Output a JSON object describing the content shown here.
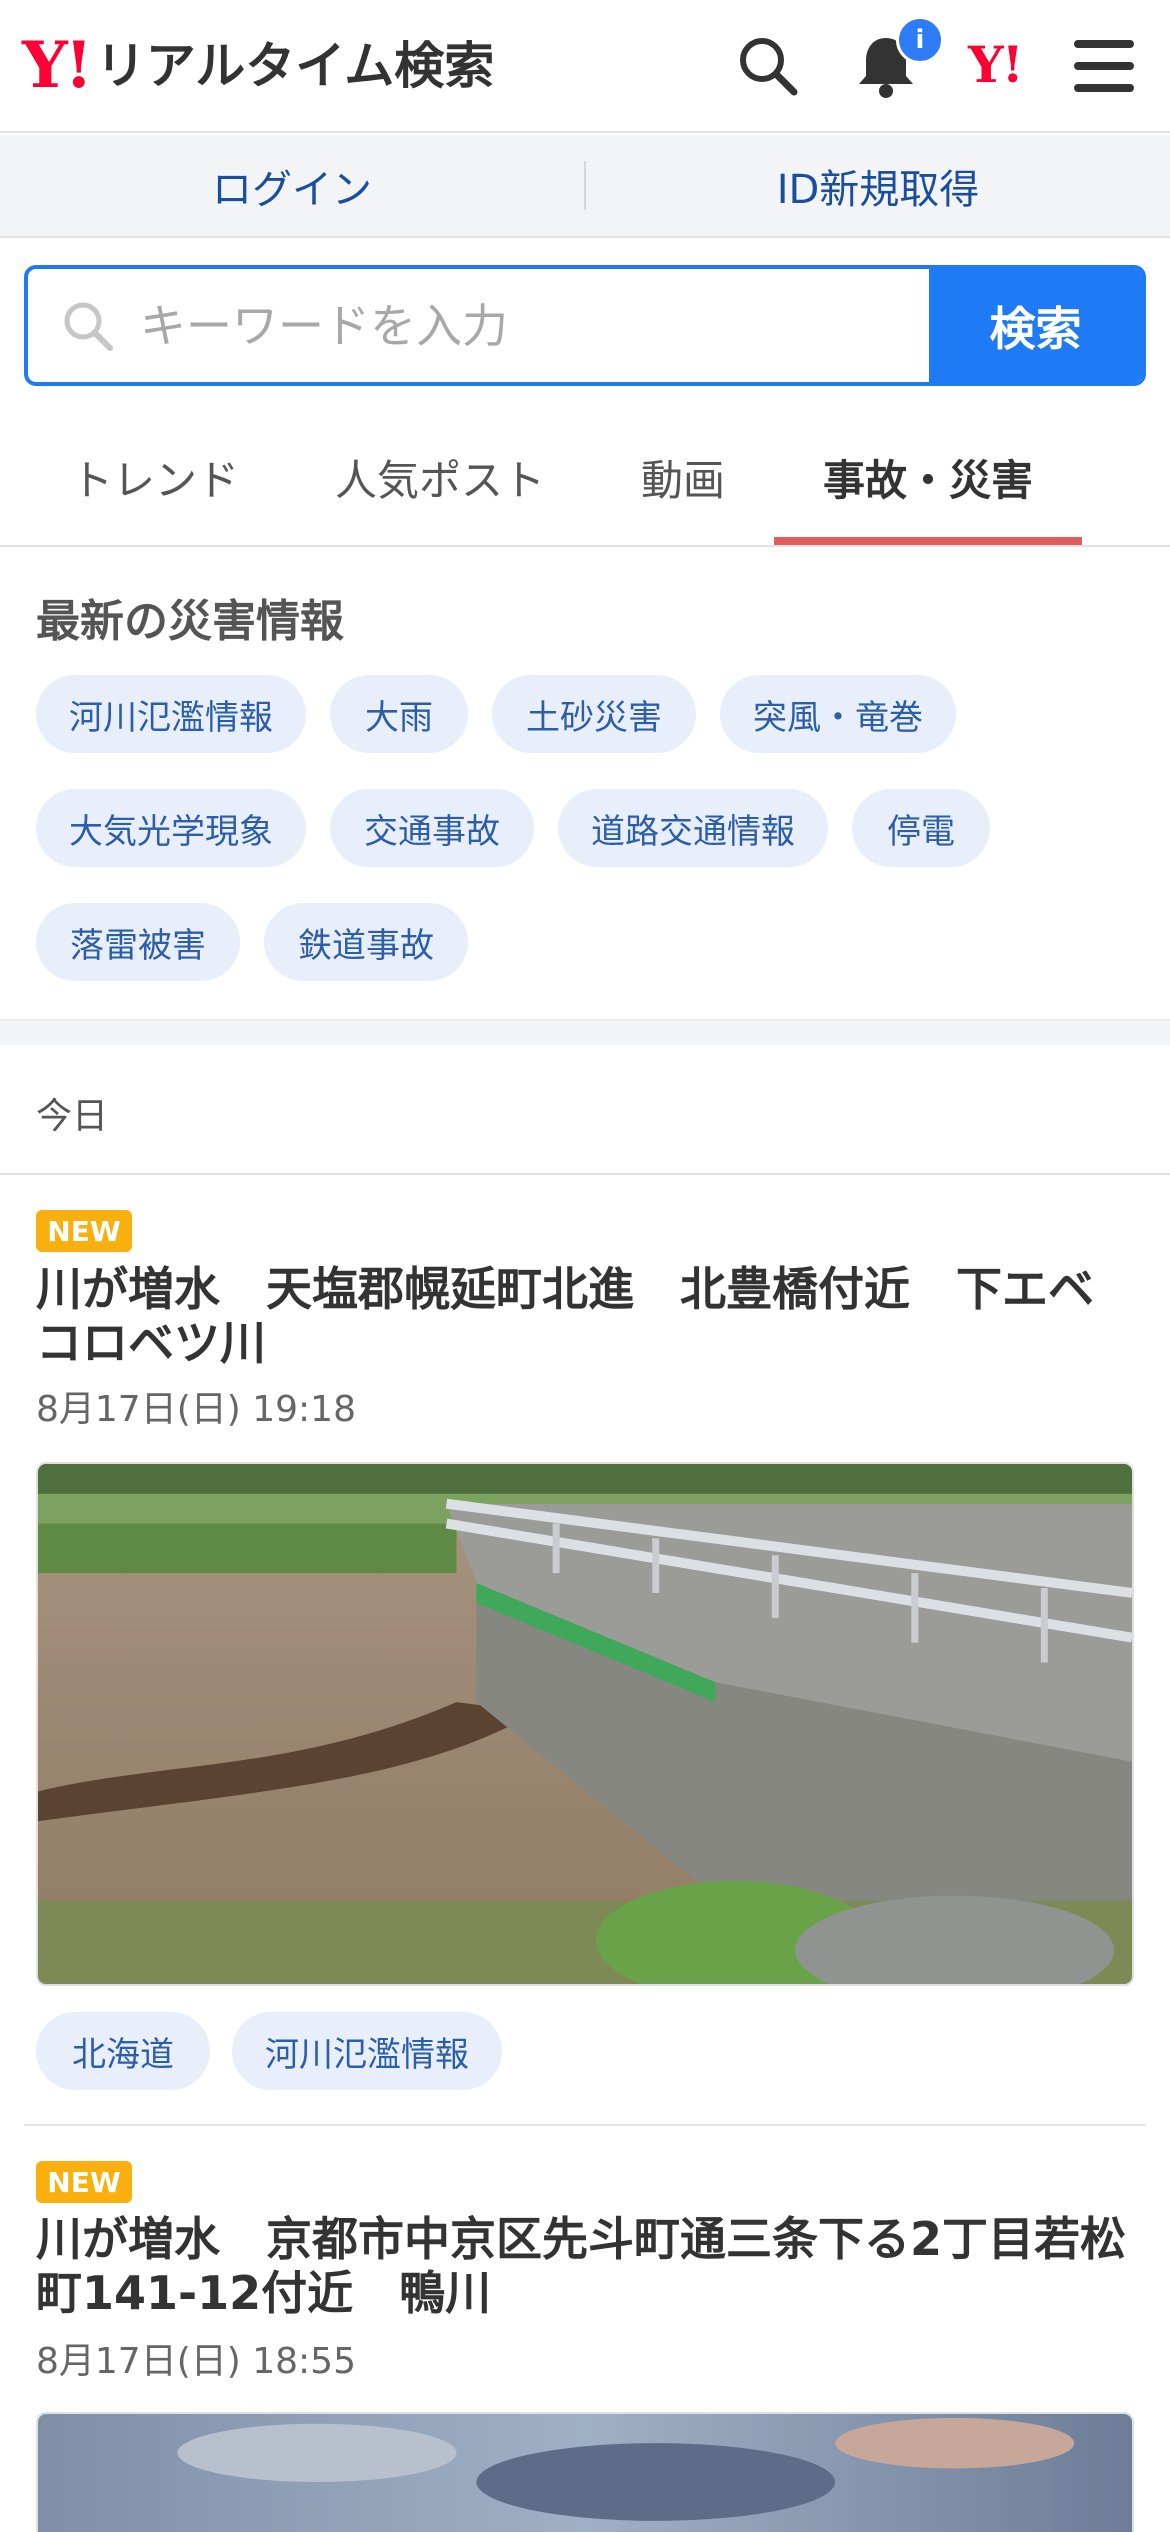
{
  "header": {
    "logo_mark": "Y!",
    "logo_text": "リアルタイム検索",
    "notification_badge": "i",
    "yahoo_icon_text": "Y!"
  },
  "login_bar": {
    "login": "ログイン",
    "register": "ID新規取得"
  },
  "search": {
    "placeholder": "キーワードを入力",
    "button": "検索"
  },
  "tabs": [
    "トレンド",
    "人気ポスト",
    "動画",
    "事故・災害"
  ],
  "disaster": {
    "title": "最新の災害情報",
    "chips": [
      "河川氾濫情報",
      "大雨",
      "土砂災害",
      "突風・竜巻",
      "大気光学現象",
      "交通事故",
      "道路交通情報",
      "停電",
      "落雷被害",
      "鉄道事故"
    ]
  },
  "day_label": "今日",
  "posts": [
    {
      "badge": "NEW",
      "title": "川が増水　天塩郡幌延町北進　北豊橋付近　下エベコロベツ川",
      "date": "8月17日(日) 19:18",
      "tags": [
        "北海道",
        "河川氾濫情報"
      ]
    },
    {
      "badge": "NEW",
      "title": "川が増水　京都市中京区先斗町通三条下る2丁目若松町141-12付近　鴨川",
      "date": "8月17日(日) 18:55"
    }
  ],
  "colors": {
    "brand_red": "#ff0033",
    "accent_blue": "#1f7af5",
    "tab_underline": "#e25c5c",
    "chip_bg": "#e8effb",
    "new_badge": "#f9b00e"
  }
}
